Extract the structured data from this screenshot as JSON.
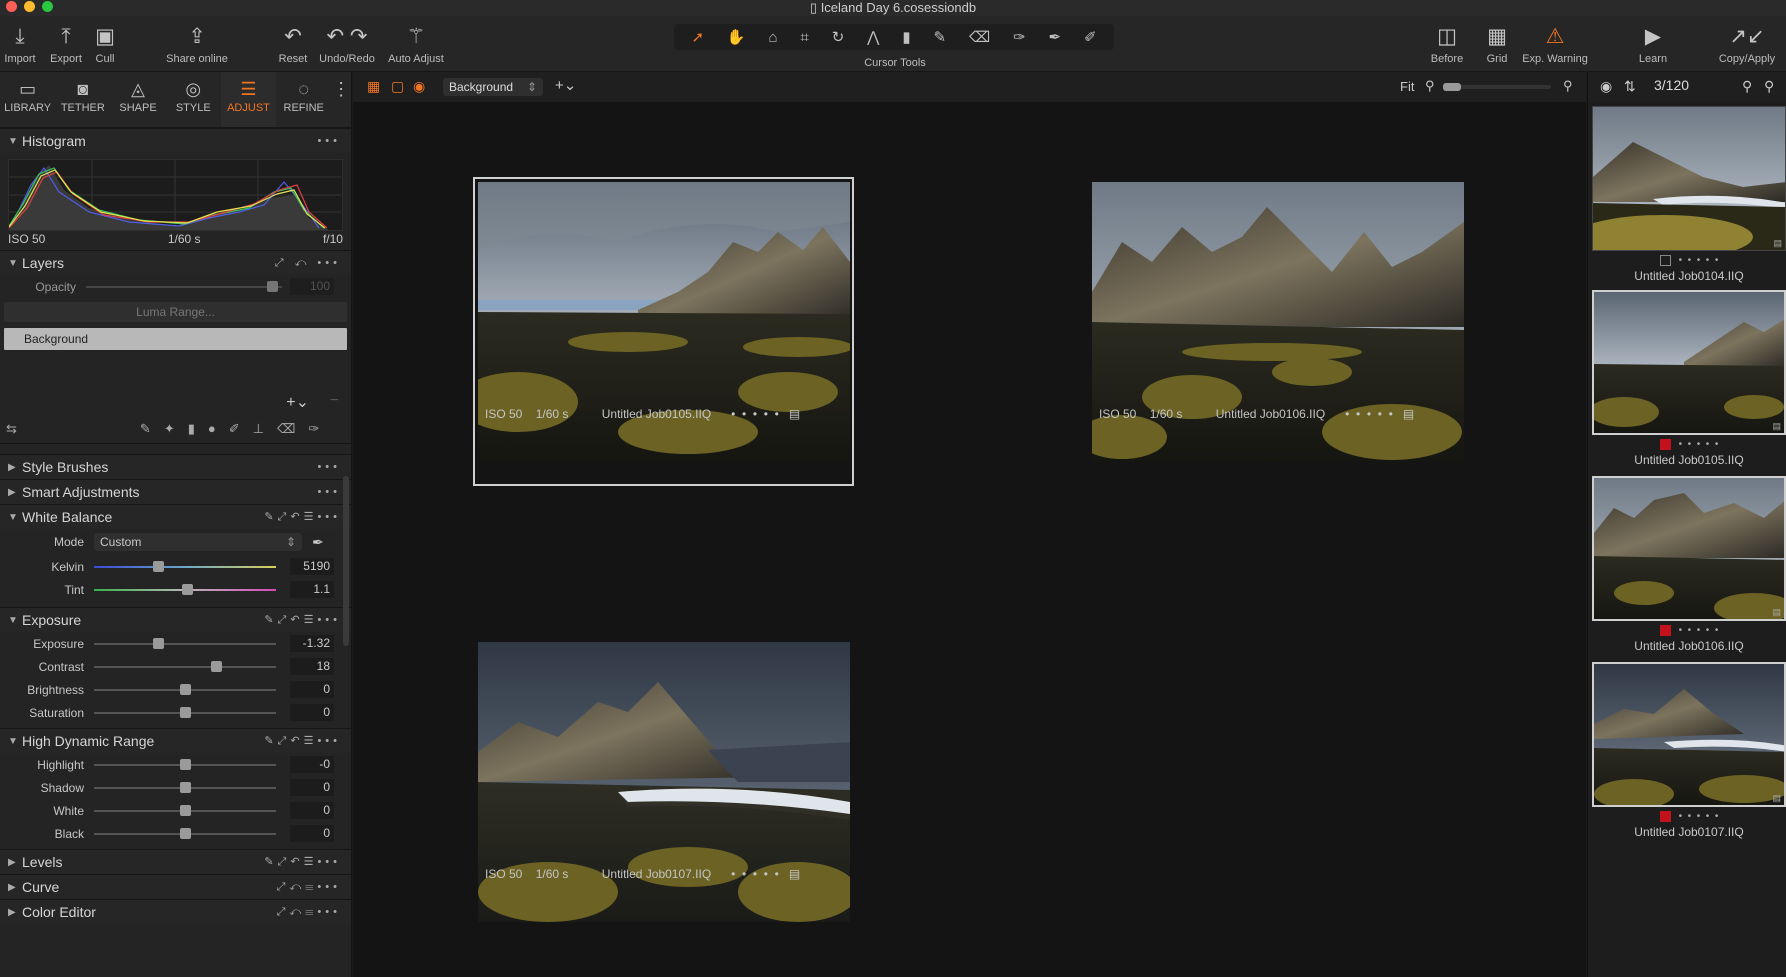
{
  "window": {
    "title": "Iceland Day 6.cosessiondb"
  },
  "toolbar": {
    "import": "Import",
    "export": "Export",
    "cull": "Cull",
    "share": "Share online",
    "reset": "Reset",
    "undo_redo": "Undo/Redo",
    "auto_adjust": "Auto Adjust",
    "cursor_tools": "Cursor Tools",
    "before": "Before",
    "grid": "Grid",
    "exp_warning": "Exp. Warning",
    "learn": "Learn",
    "copy_apply": "Copy/Apply"
  },
  "tool_tabs": [
    "LIBRARY",
    "TETHER",
    "SHAPE",
    "STYLE",
    "ADJUST",
    "REFINE"
  ],
  "histogram": {
    "title": "Histogram",
    "iso": "ISO 50",
    "shutter": "1/60 s",
    "aperture": "f/10"
  },
  "layers": {
    "title": "Layers",
    "opacity_label": "Opacity",
    "opacity_value": "100",
    "luma_button": "Luma Range...",
    "selected_layer": "Background"
  },
  "sections": {
    "style_brushes": "Style Brushes",
    "smart_adjustments": "Smart Adjustments",
    "white_balance": "White Balance",
    "exposure": "Exposure",
    "hdr": "High Dynamic Range",
    "levels": "Levels",
    "curve": "Curve",
    "color_editor": "Color Editor"
  },
  "white_balance": {
    "mode_label": "Mode",
    "mode_value": "Custom",
    "kelvin_label": "Kelvin",
    "kelvin_value": "5190",
    "kelvin_level": 0.35,
    "tint_label": "Tint",
    "tint_value": "1.1",
    "tint_level": 0.51
  },
  "exposure": [
    {
      "label": "Exposure",
      "value": "-1.32",
      "level": 0.35
    },
    {
      "label": "Contrast",
      "value": "18",
      "level": 0.67
    },
    {
      "label": "Brightness",
      "value": "0",
      "level": 0.5
    },
    {
      "label": "Saturation",
      "value": "0",
      "level": 0.5
    }
  ],
  "hdr": [
    {
      "label": "Highlight",
      "value": "-0",
      "level": 0.5
    },
    {
      "label": "Shadow",
      "value": "0",
      "level": 0.5
    },
    {
      "label": "White",
      "value": "0",
      "level": 0.5
    },
    {
      "label": "Black",
      "value": "0",
      "level": 0.5
    }
  ],
  "viewer": {
    "layer": "Background",
    "fit": "Fit",
    "counter": "3/120"
  },
  "photos": [
    {
      "iso": "ISO 50",
      "shutter": "1/60 s",
      "name": "Untitled Job0105.IIQ"
    },
    {
      "iso": "ISO 50",
      "shutter": "1/60 s",
      "name": "Untitled Job0106.IIQ"
    },
    {
      "iso": "ISO 50",
      "shutter": "1/60 s",
      "name": "Untitled Job0107.IIQ"
    }
  ],
  "thumbnails": [
    {
      "name": "Untitled Job0104.IIQ",
      "color_tag": "none"
    },
    {
      "name": "Untitled Job0105.IIQ",
      "color_tag": "#c4121c"
    },
    {
      "name": "Untitled Job0106.IIQ",
      "color_tag": "#c4121c"
    },
    {
      "name": "Untitled Job0107.IIQ",
      "color_tag": "#c4121c"
    }
  ],
  "colors": {
    "accent": "#f07522",
    "red_tag": "#c4121c"
  }
}
